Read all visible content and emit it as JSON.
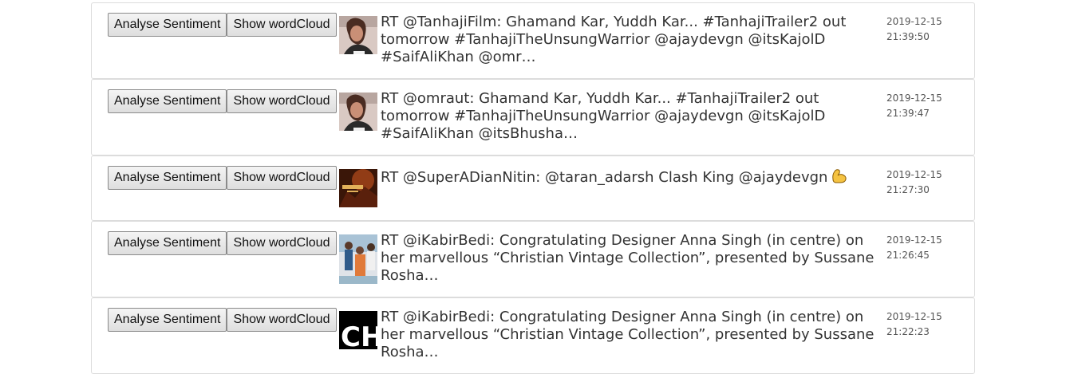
{
  "buttons": {
    "analyse_label": "Analyse Sentiment",
    "wordcloud_label": "Show wordCloud"
  },
  "tweets": [
    {
      "text": "RT @TanhajiFilm: Ghamand Kar, Yuddh Kar... #TanhajiTrailer2 out tomorrow #TanhajiTheUnsungWarrior @ajaydevgn @itsKajolD #SaifAliKhan @omr…",
      "date": "2019-12-15",
      "time": "21:39:50",
      "thumbnail": "portrait-woman-icon"
    },
    {
      "text": "RT @omraut: Ghamand Kar, Yuddh Kar... #TanhajiTrailer2 out tomorrow #TanhajiTheUnsungWarrior @ajaydevgn @itsKajolD #SaifAliKhan @itsBhusha…",
      "date": "2019-12-15",
      "time": "21:39:47",
      "thumbnail": "portrait-woman-icon"
    },
    {
      "text": "RT @SuperADianNitin: @taran_adarsh Clash King @ajaydevgn",
      "date": "2019-12-15",
      "time": "21:27:30",
      "thumbnail": "tanhaji-poster-icon",
      "emoji": "flexed-biceps-icon"
    },
    {
      "text": "RT @iKabirBedi: Congratulating Designer Anna Singh (in centre) on her marvellous “Christian Vintage Collection”, presented by Sussane Rosha…",
      "date": "2019-12-15",
      "time": "21:26:45",
      "thumbnail": "group-photo-icon"
    },
    {
      "text": "RT @iKabirBedi: Congratulating Designer Anna Singh (in centre) on her marvellous “Christian Vintage Collection”, presented by Sussane Rosha…",
      "date": "2019-12-15",
      "time": "21:22:23",
      "thumbnail": "ch-logo-icon"
    }
  ],
  "colors": {
    "text": "#333333",
    "border": "#dcdcdc",
    "button_bg": "#e6e6e6"
  }
}
